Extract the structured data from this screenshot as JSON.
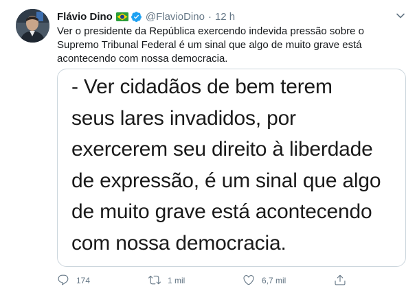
{
  "tweet": {
    "author_name": "Flávio Dino",
    "handle": "@FlavioDino",
    "separator": "·",
    "time": "12 h",
    "text": "Ver o presidente da República  exercendo indevida pressão sobre o Supremo Tribunal Federal é um sinal que algo de muito grave está acontecendo com nossa democracia.",
    "media_text": "- Ver cidadãos de bem terem\nseus lares invadidos, por\nexercerem seu direito à liberdade\nde expressão, é um sinal que algo\nde muito grave está acontecendo\ncom nossa democracia."
  },
  "actions": {
    "replies": "174",
    "retweets": "1 mil",
    "likes": "6,7 mil"
  },
  "icons": {
    "flag": "brazil-flag-icon",
    "verified": "verified-badge-icon",
    "caret": "chevron-down-icon",
    "reply": "reply-icon",
    "retweet": "retweet-icon",
    "like": "heart-icon",
    "share": "share-icon"
  },
  "colors": {
    "text_primary": "#14171a",
    "text_secondary": "#657786",
    "verified_blue": "#1da1f2",
    "media_border": "#ccd6dd"
  }
}
